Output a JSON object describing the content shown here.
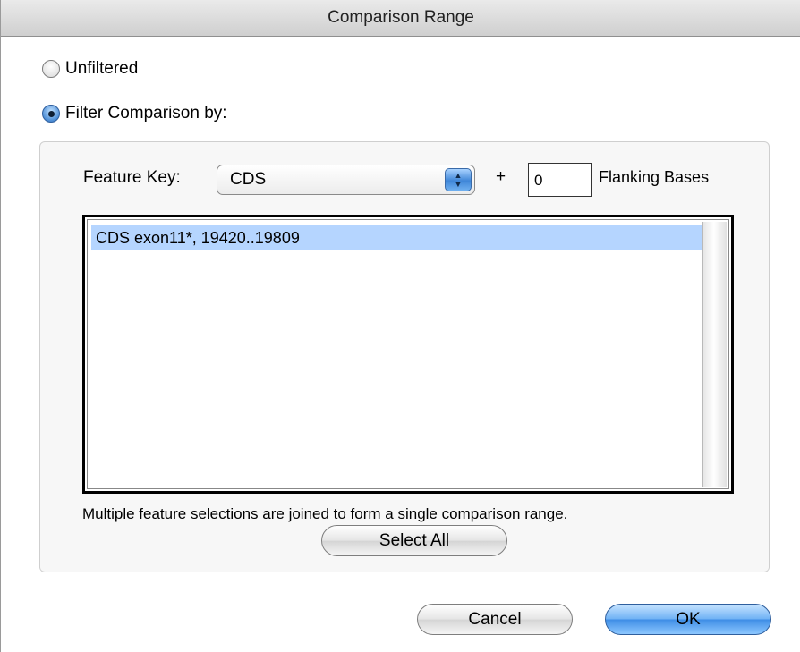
{
  "window": {
    "title": "Comparison Range"
  },
  "options": {
    "unfiltered": {
      "label": "Unfiltered",
      "selected": false
    },
    "filter": {
      "label": "Filter Comparison by:",
      "selected": true
    }
  },
  "feature_key": {
    "label": "Feature Key:",
    "value": "CDS",
    "plus": "+",
    "flanking_value": "0",
    "flanking_label": "Flanking Bases"
  },
  "feature_list": {
    "items": [
      {
        "label": "CDS exon11*, 19420..19809",
        "selected": true
      }
    ]
  },
  "hint": "Multiple feature selections are joined to form a single comparison range.",
  "buttons": {
    "select_all": "Select All",
    "cancel": "Cancel",
    "ok": "OK"
  }
}
